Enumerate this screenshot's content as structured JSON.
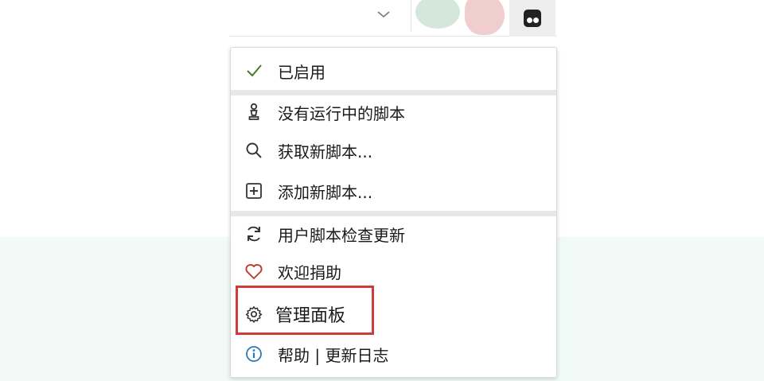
{
  "menu": {
    "enabled": {
      "label": "已启用",
      "icon": "checkmark-icon"
    },
    "no_scripts": {
      "label": "没有运行中的脚本",
      "icon": "chess-pawn-icon"
    },
    "get_scripts": {
      "label": "获取新脚本...",
      "icon": "search-icon"
    },
    "add_script": {
      "label": "添加新脚本...",
      "icon": "plus-square-icon"
    },
    "check_updates": {
      "label": "用户脚本检查更新",
      "icon": "refresh-icon"
    },
    "donate": {
      "label": "欢迎捐助",
      "icon": "heart-icon"
    },
    "dashboard": {
      "label": "管理面板",
      "icon": "gear-icon"
    },
    "help": {
      "label": "帮助 | 更新日志",
      "icon": "info-icon"
    }
  },
  "colors": {
    "check": "#4a7a2c",
    "heart": "#c0392b",
    "info": "#2b79b8",
    "highlight": "#cf3a3a"
  }
}
